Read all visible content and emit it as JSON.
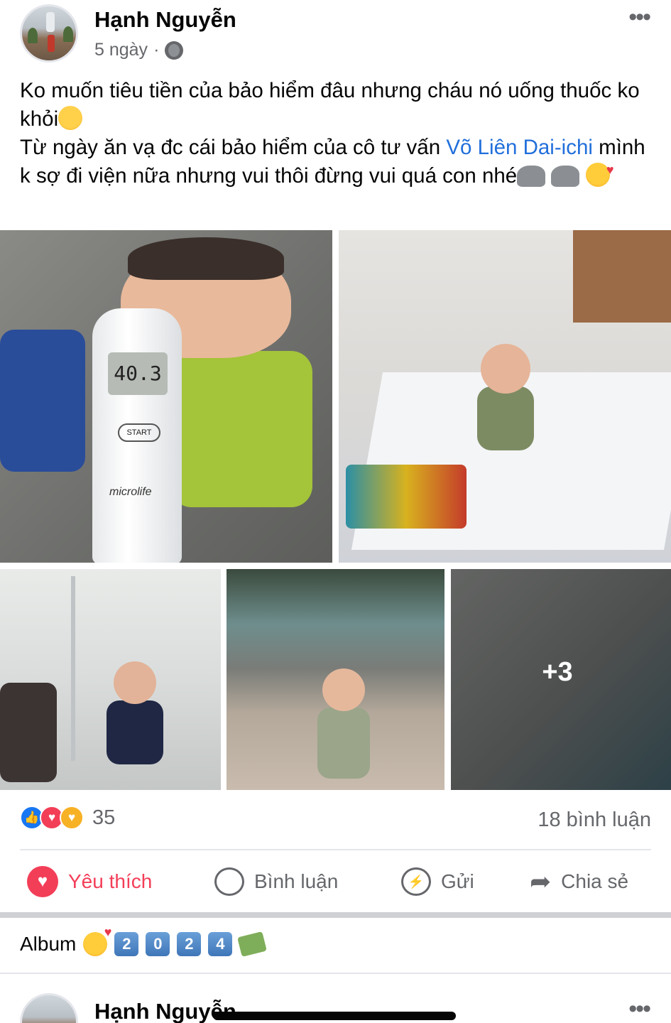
{
  "post": {
    "author": "Hạnh Nguyễn",
    "time": "5 ngày",
    "separator": "·",
    "privacy_icon": "globe-icon",
    "more_icon": "•••",
    "text": {
      "line1": "Ko muốn tiêu tiền của bảo hiểm đâu nhưng cháu nó uống thuốc ko khỏi",
      "line2_prefix": "Từ ngày ăn vạ đc cái bảo hiểm của cô tư vấn ",
      "mention": "Võ Liên Dai-ichi",
      "line2_suffix": " mình k sợ đi viện nữa nhưng vui thôi đừng vui quá con nhé"
    },
    "photos": {
      "thermometer_reading": "40.3",
      "thermometer_button": "START",
      "thermometer_brand": "microlife",
      "more_count": "+3"
    },
    "reactions": {
      "icons": [
        "like-icon",
        "love-icon",
        "care-icon"
      ],
      "count": "35",
      "comments": "18 bình luận"
    },
    "actions": {
      "like": "Yêu thích",
      "comment": "Bình luận",
      "send": "Gửi",
      "share": "Chia sẻ"
    }
  },
  "album": {
    "label": "Album",
    "year_digits": [
      "2",
      "0",
      "2",
      "4"
    ]
  },
  "next_post": {
    "author": "Hạnh Nguyễn",
    "more_icon": "•••"
  },
  "colors": {
    "link": "#216fdb",
    "like_red": "#f33e58",
    "muted": "#65676b",
    "facebook_blue": "#1877f2"
  }
}
